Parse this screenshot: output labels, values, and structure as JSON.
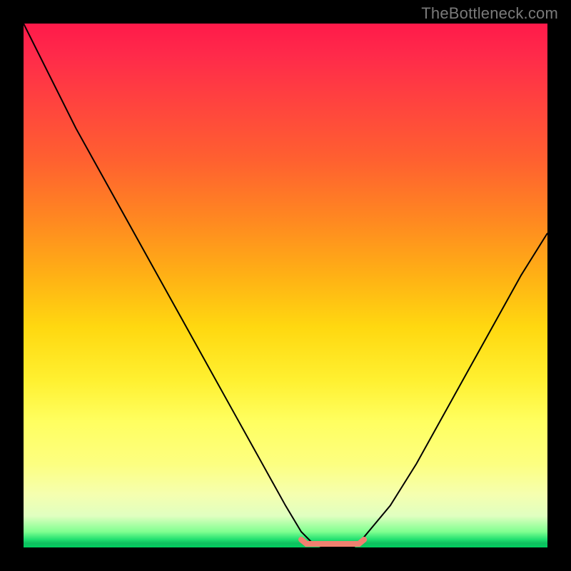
{
  "watermark": "TheBottleneck.com",
  "colors": {
    "border": "#000000",
    "curve": "#000000",
    "bottom_marker": "#f08070",
    "gradient_top": "#ff1a4a",
    "gradient_mid": "#ffe040",
    "gradient_bottom": "#20e070"
  },
  "chart_data": {
    "type": "line",
    "title": "",
    "xlabel": "",
    "ylabel": "",
    "xlim": [
      0,
      100
    ],
    "ylim": [
      0,
      100
    ],
    "grid": false,
    "x": [
      0,
      5,
      10,
      15,
      20,
      25,
      30,
      35,
      40,
      45,
      50,
      53,
      55,
      57,
      60,
      63,
      65,
      70,
      75,
      80,
      85,
      90,
      95,
      100
    ],
    "y": [
      100,
      90,
      80,
      71,
      62,
      53,
      44,
      35,
      26,
      17,
      8,
      3,
      1,
      0,
      0,
      0,
      2,
      8,
      16,
      25,
      34,
      43,
      52,
      60
    ],
    "bottom_marker": {
      "x0": 53,
      "x1": 65,
      "y": 0
    }
  }
}
